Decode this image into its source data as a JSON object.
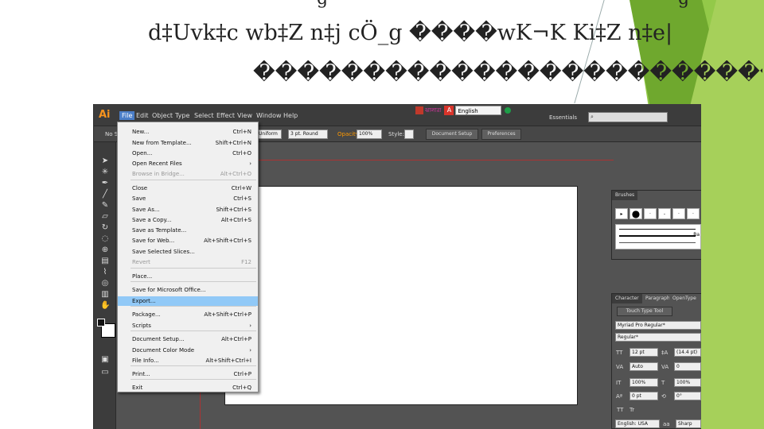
{
  "slide": {
    "top_scrap": "g",
    "top_scrap_2": "g",
    "title": "d‡Uvk‡c wb‡Z n‡j cÖ_g ����wK¬K Ki‡Z n‡e|",
    "subtitle": "��������������������������"
  },
  "app": {
    "logo": "Ai",
    "menus": [
      "File",
      "Edit",
      "Object",
      "Type",
      "Select",
      "Effect",
      "View",
      "Window",
      "Help"
    ],
    "lang_text": "ঝালারা",
    "lang_icon_letter": "A",
    "language": "English",
    "workspace": "Essentials",
    "search_placeholder": "",
    "control": {
      "no_selection": "No S",
      "uniform": "Uniform",
      "stroke": "3 pt. Round",
      "opacity_label": "Opacity:",
      "opacity": "100%",
      "style_label": "Style:",
      "doc_setup": "Document Setup",
      "preferences": "Preferences"
    },
    "file_menu": [
      {
        "label": "New...",
        "shortcut": "Ctrl+N",
        "disabled": false
      },
      {
        "label": "New from Template...",
        "shortcut": "Shift+Ctrl+N",
        "disabled": false
      },
      {
        "label": "Open...",
        "shortcut": "Ctrl+O",
        "disabled": false
      },
      {
        "label": "Open Recent Files",
        "shortcut": "›",
        "disabled": false
      },
      {
        "label": "Browse in Bridge...",
        "shortcut": "Alt+Ctrl+O",
        "disabled": true
      },
      {
        "label": "Close",
        "shortcut": "Ctrl+W",
        "disabled": false
      },
      {
        "label": "Save",
        "shortcut": "Ctrl+S",
        "disabled": false
      },
      {
        "label": "Save As...",
        "shortcut": "Shift+Ctrl+S",
        "disabled": false
      },
      {
        "label": "Save a Copy...",
        "shortcut": "Alt+Ctrl+S",
        "disabled": false
      },
      {
        "label": "Save as Template...",
        "shortcut": "",
        "disabled": false
      },
      {
        "label": "Save for Web...",
        "shortcut": "Alt+Shift+Ctrl+S",
        "disabled": false
      },
      {
        "label": "Save Selected Slices...",
        "shortcut": "",
        "disabled": false
      },
      {
        "label": "Revert",
        "shortcut": "F12",
        "disabled": true
      },
      {
        "label": "Place...",
        "shortcut": "",
        "disabled": false
      },
      {
        "label": "Save for Microsoft Office...",
        "shortcut": "",
        "disabled": false
      },
      {
        "label": "Export...",
        "shortcut": "",
        "disabled": false,
        "highlighted": true
      },
      {
        "label": "Package...",
        "shortcut": "Alt+Shift+Ctrl+P",
        "disabled": false
      },
      {
        "label": "Scripts",
        "shortcut": "›",
        "disabled": false
      },
      {
        "label": "Document Setup...",
        "shortcut": "Alt+Ctrl+P",
        "disabled": false
      },
      {
        "label": "Document Color Mode",
        "shortcut": "›",
        "disabled": false
      },
      {
        "label": "File Info...",
        "shortcut": "Alt+Shift+Ctrl+I",
        "disabled": false
      },
      {
        "label": "Print...",
        "shortcut": "Ctrl+P",
        "disabled": false
      },
      {
        "label": "Exit",
        "shortcut": "Ctrl+Q",
        "disabled": false
      }
    ],
    "brushes_panel": {
      "tab": "Brushes",
      "brush_label": "Ba"
    },
    "character_panel": {
      "tabs": [
        "Character",
        "Paragraph",
        "OpenType"
      ],
      "touch_type": "Touch Type Tool",
      "font": "Myriad Pro Regular*",
      "style": "Regular*",
      "size": "12 pt",
      "leading": "(14.4 pt)",
      "kerning": "Auto",
      "tracking": "0",
      "hscale": "100%",
      "vscale": "100%",
      "baseline": "0 pt",
      "rotation": "0°",
      "caps_a": "TT",
      "caps_b": "Tr",
      "language": "English: USA",
      "aa": "Sharp"
    }
  }
}
